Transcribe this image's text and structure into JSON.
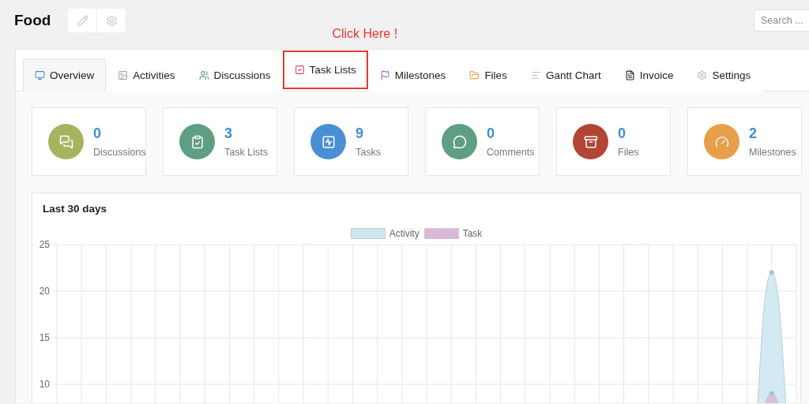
{
  "project": {
    "title": "Food"
  },
  "search": {
    "placeholder": "Search ..."
  },
  "annotation": {
    "text": "Click Here !"
  },
  "tabs": [
    {
      "label": "Overview",
      "selected": true,
      "highlighted": false
    },
    {
      "label": "Activities",
      "selected": false,
      "highlighted": false
    },
    {
      "label": "Discussions",
      "selected": false,
      "highlighted": false
    },
    {
      "label": "Task Lists",
      "selected": false,
      "highlighted": true
    },
    {
      "label": "Milestones",
      "selected": false,
      "highlighted": false
    },
    {
      "label": "Files",
      "selected": false,
      "highlighted": false
    },
    {
      "label": "Gantt Chart",
      "selected": false,
      "highlighted": false
    },
    {
      "label": "Invoice",
      "selected": false,
      "highlighted": false
    },
    {
      "label": "Settings",
      "selected": false,
      "highlighted": false
    }
  ],
  "stats": [
    {
      "count": "0",
      "label": "Discussions",
      "color": "#a5b55f"
    },
    {
      "count": "3",
      "label": "Task Lists",
      "color": "#5e9e82"
    },
    {
      "count": "9",
      "label": "Tasks",
      "color": "#4a8fd6"
    },
    {
      "count": "0",
      "label": "Comments",
      "color": "#5e9e82"
    },
    {
      "count": "0",
      "label": "Files",
      "color": "#b24535"
    },
    {
      "count": "2",
      "label": "Milestones",
      "color": "#e89f4a"
    }
  ],
  "activity_card": {
    "title": "Last 30 days",
    "chart_data": {
      "type": "area",
      "grid": true,
      "ylim": [
        0,
        25
      ],
      "yticks": [
        10,
        15,
        20,
        25
      ],
      "series": [
        {
          "name": "Activity",
          "color": "#cde6f0",
          "values": [
            0,
            0,
            0,
            0,
            0,
            0,
            0,
            0,
            0,
            0,
            0,
            0,
            0,
            0,
            0,
            0,
            0,
            0,
            0,
            0,
            0,
            0,
            0,
            0,
            0,
            0,
            0,
            0,
            0,
            22,
            0
          ]
        },
        {
          "name": "Task",
          "color": "#d9b8d9",
          "values": [
            0,
            0,
            0,
            0,
            0,
            0,
            0,
            0,
            0,
            0,
            0,
            0,
            0,
            0,
            0,
            0,
            0,
            0,
            0,
            0,
            0,
            0,
            0,
            0,
            0,
            0,
            0,
            0,
            0,
            9,
            0
          ]
        }
      ]
    }
  }
}
